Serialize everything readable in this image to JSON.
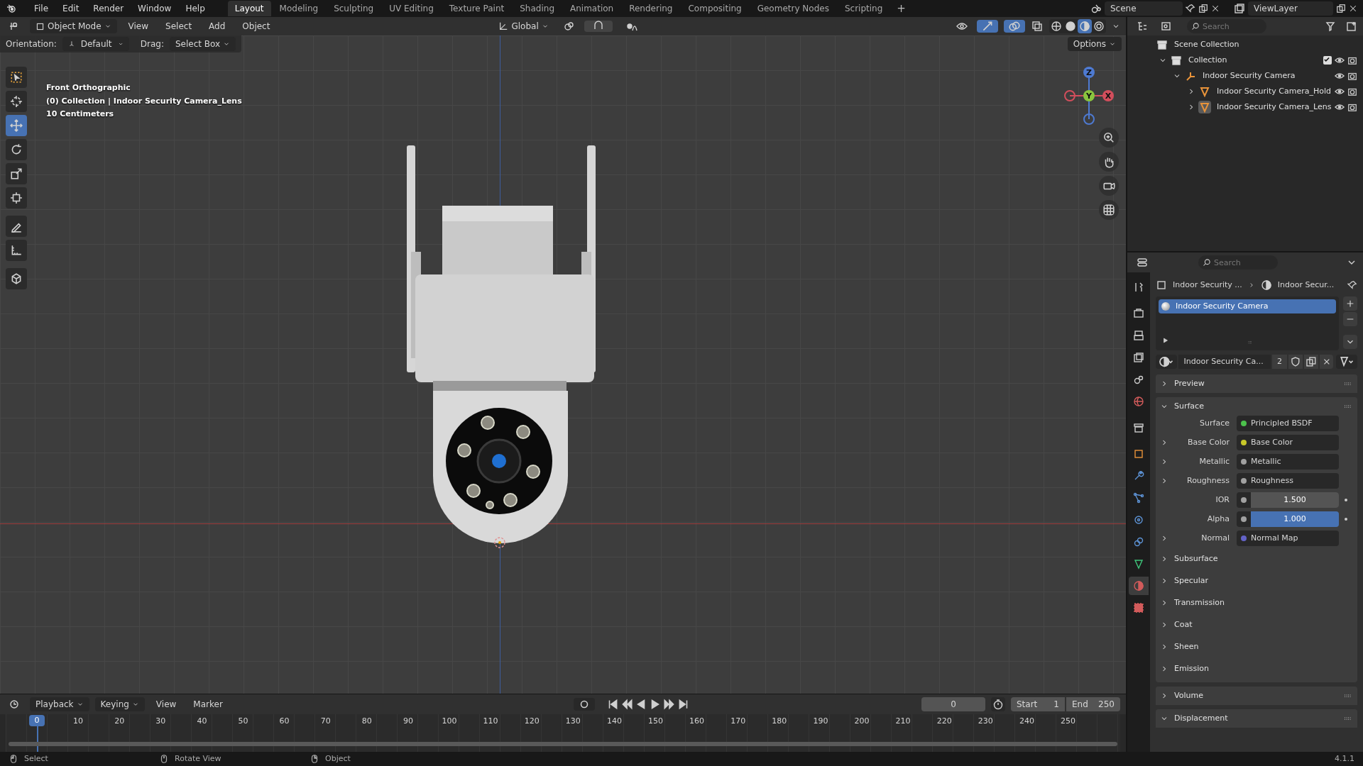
{
  "menu": [
    "File",
    "Edit",
    "Render",
    "Window",
    "Help"
  ],
  "workspaces": [
    {
      "label": "Layout",
      "selected": true
    },
    {
      "label": "Modeling",
      "selected": false
    },
    {
      "label": "Sculpting",
      "selected": false
    },
    {
      "label": "UV Editing",
      "selected": false
    },
    {
      "label": "Texture Paint",
      "selected": false
    },
    {
      "label": "Shading",
      "selected": false
    },
    {
      "label": "Animation",
      "selected": false
    },
    {
      "label": "Rendering",
      "selected": false
    },
    {
      "label": "Compositing",
      "selected": false
    },
    {
      "label": "Geometry Nodes",
      "selected": false
    },
    {
      "label": "Scripting",
      "selected": false
    }
  ],
  "add_workspace": "+",
  "scene": "Scene",
  "view_layer": "ViewLayer",
  "viewport": {
    "mode": "Object Mode",
    "menus": [
      "View",
      "Select",
      "Add",
      "Object"
    ],
    "transform": "Global",
    "orientation_label": "Orientation:",
    "orientation": "Default",
    "drag_label": "Drag:",
    "drag": "Select Box",
    "options": "Options",
    "overlay": [
      "Front Orthographic",
      "(0) Collection | Indoor Security Camera_Lens",
      "10 Centimeters"
    ],
    "tools": [
      {
        "kind": "select",
        "selected": false
      },
      {
        "kind": "cursor",
        "selected": false
      },
      {
        "kind": "move",
        "selected": true
      },
      {
        "kind": "rotate",
        "selected": false
      },
      {
        "kind": "scale",
        "selected": false
      },
      {
        "kind": "transform",
        "selected": false
      },
      {
        "kind": "annotate",
        "selected": false
      },
      {
        "kind": "measure",
        "selected": false
      },
      {
        "kind": "add-cube",
        "selected": false
      }
    ],
    "shading": [
      {
        "kind": "wireframe",
        "selected": false
      },
      {
        "kind": "solid",
        "selected": false
      },
      {
        "kind": "material",
        "selected": true
      },
      {
        "kind": "rendered",
        "selected": false
      }
    ],
    "gizmo": [
      "Z",
      "Y",
      "X"
    ]
  },
  "outliner": {
    "search": {
      "placeholder": "Search"
    },
    "tree": [
      {
        "label": "Scene Collection",
        "kind": "scene",
        "children": [
          {
            "label": "Collection",
            "kind": "collection",
            "expanded": true,
            "checked": true,
            "children": [
              {
                "label": "Indoor Security Camera",
                "kind": "empty",
                "expanded": true,
                "children": [
                  {
                    "label": "Indoor Security Camera_Hold",
                    "kind": "mesh",
                    "expanded": false,
                    "selected": false
                  },
                  {
                    "label": "Indoor Security Camera_Lens",
                    "kind": "mesh",
                    "expanded": false,
                    "selected": true
                  }
                ]
              }
            ]
          }
        ]
      }
    ]
  },
  "properties": {
    "search": {
      "placeholder": "Search"
    },
    "tabs": [
      {
        "kind": "tool",
        "selected": false
      },
      {
        "kind": "render",
        "selected": false
      },
      {
        "kind": "output",
        "selected": false
      },
      {
        "kind": "view-layer",
        "selected": false
      },
      {
        "kind": "scene",
        "selected": false
      },
      {
        "kind": "world",
        "selected": false
      },
      {
        "kind": "collection",
        "selected": false
      },
      {
        "kind": "object",
        "selected": false
      },
      {
        "kind": "modifiers",
        "selected": false
      },
      {
        "kind": "particles",
        "selected": false
      },
      {
        "kind": "physics",
        "selected": false
      },
      {
        "kind": "constraints",
        "selected": false
      },
      {
        "kind": "data",
        "selected": false
      },
      {
        "kind": "material",
        "selected": true
      },
      {
        "kind": "texture",
        "selected": false
      }
    ],
    "breadcrumb": [
      "Indoor Security ...",
      "Indoor Secur..."
    ],
    "slots": [
      {
        "label": "Indoor Security Camera",
        "selected": true
      }
    ],
    "material": "Indoor Security Ca...",
    "users": "2",
    "panels": [
      {
        "title": "Preview",
        "expanded": false
      },
      {
        "title": "Surface",
        "expanded": true,
        "fields": [
          {
            "kind": "link",
            "label": "Surface",
            "value": "Principled BSDF",
            "color": "#4cc14c",
            "expandable": false
          },
          {
            "kind": "link",
            "label": "Base Color",
            "value": "Base Color",
            "color": "#c7c729",
            "expandable": true
          },
          {
            "kind": "link",
            "label": "Metallic",
            "value": "Metallic",
            "color": "#a1a1a1",
            "expandable": true
          },
          {
            "kind": "link",
            "label": "Roughness",
            "value": "Roughness",
            "color": "#a1a1a1",
            "expandable": true
          },
          {
            "kind": "number",
            "label": "IOR",
            "value": "1.500",
            "color": "#a1a1a1",
            "expandable": false
          },
          {
            "kind": "slider",
            "label": "Alpha",
            "value": "1.000",
            "color": "#a1a1a1",
            "level": 1,
            "expandable": false
          },
          {
            "kind": "link",
            "label": "Normal",
            "value": "Normal Map",
            "color": "#6363c7",
            "expandable": true
          }
        ],
        "subpanels": [
          {
            "title": "Subsurface",
            "expanded": false
          },
          {
            "title": "Specular",
            "expanded": false
          },
          {
            "title": "Transmission",
            "expanded": false
          },
          {
            "title": "Coat",
            "expanded": false
          },
          {
            "title": "Sheen",
            "expanded": false
          },
          {
            "title": "Emission",
            "expanded": false
          }
        ]
      },
      {
        "title": "Volume",
        "expanded": false
      },
      {
        "title": "Displacement",
        "expanded": true
      }
    ]
  },
  "timeline": {
    "menus": [
      "Playback",
      "Keying",
      "View",
      "Marker"
    ],
    "frame": "0",
    "start_label": "Start",
    "start": "1",
    "end_label": "End",
    "end": "250",
    "playhead": "0",
    "ticks": [
      "10",
      "20",
      "30",
      "40",
      "50",
      "60",
      "70",
      "80",
      "90",
      "100",
      "110",
      "120",
      "130",
      "140",
      "150",
      "160",
      "170",
      "180",
      "190",
      "200",
      "210",
      "220",
      "230",
      "240",
      "250"
    ]
  },
  "status_bar": {
    "hints": [
      {
        "kind": "left",
        "label": "Select"
      },
      {
        "kind": "middle",
        "label": "Rotate View"
      },
      {
        "kind": "right",
        "label": "Object"
      }
    ],
    "version": "4.1.1"
  }
}
